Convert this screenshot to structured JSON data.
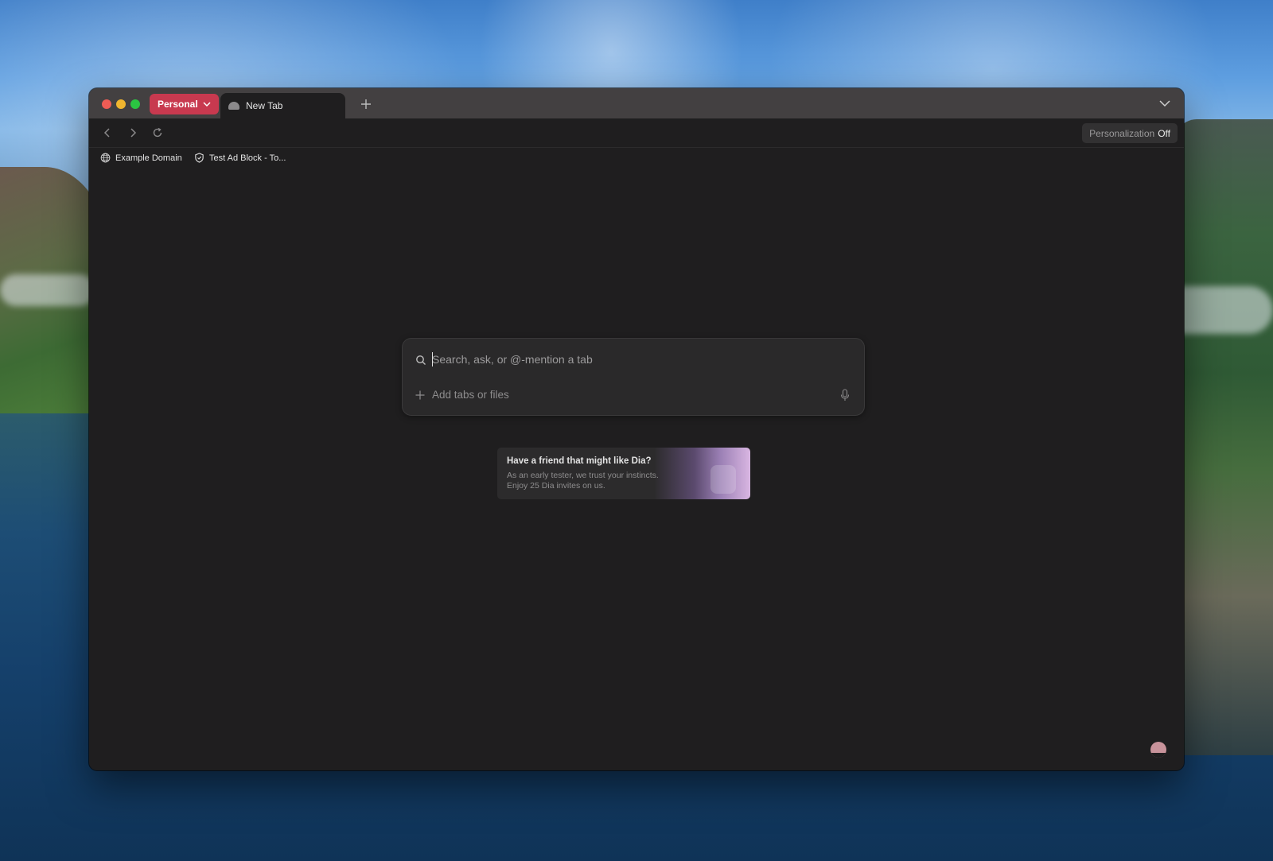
{
  "colors": {
    "accent_profile": "#c8394f",
    "window_bg": "#1f1e1f",
    "titlebar_bg": "#434041"
  },
  "window": {
    "profile_label": "Personal",
    "tabs": [
      {
        "label": "New Tab",
        "icon": "generic-favicon-icon",
        "active": true
      }
    ]
  },
  "toolbar": {
    "personalization_label": "Personalization",
    "personalization_state": "Off"
  },
  "bookmarks": [
    {
      "label": "Example Domain",
      "icon": "globe-icon"
    },
    {
      "label": "Test Ad Block - To...",
      "icon": "shield-icon"
    }
  ],
  "search": {
    "placeholder": "Search, ask, or @-mention a tab",
    "add_label": "Add tabs or files"
  },
  "promo": {
    "title": "Have a friend that might like Dia?",
    "line1": "As an early tester, we trust your instincts.",
    "line2": "Enjoy 25 Dia invites on us."
  }
}
